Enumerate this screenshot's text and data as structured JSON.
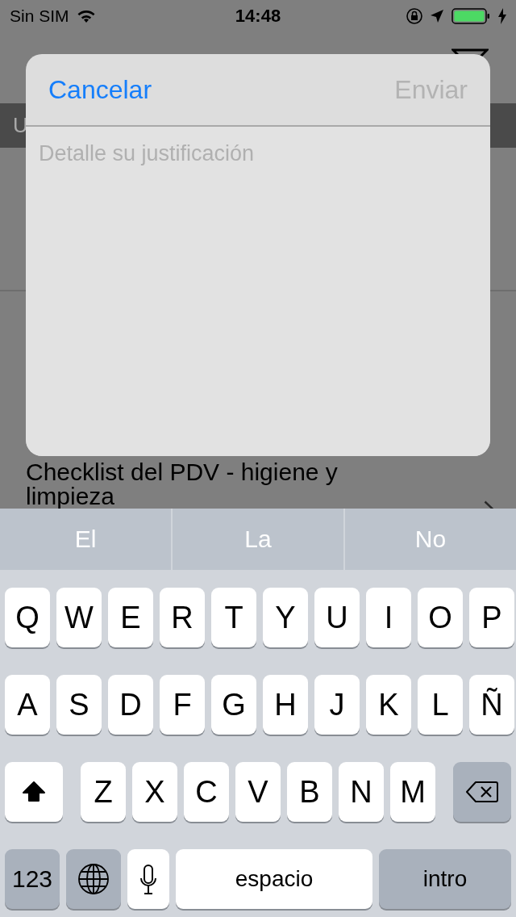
{
  "status_bar": {
    "carrier": "Sin SIM",
    "time": "14:48"
  },
  "section_header": "U",
  "list_item": {
    "title": "Checklist del PDV - higiene y limpieza"
  },
  "modal": {
    "cancel": "Cancelar",
    "send": {
      "label": "Enviar",
      "disabled": true
    },
    "placeholder": "Detalle su justificación"
  },
  "keyboard": {
    "suggestions": [
      "El",
      "La",
      "No"
    ],
    "letter_rows": [
      {
        "keys": [
          "Q",
          "W",
          "E",
          "R",
          "T",
          "Y",
          "U",
          "I",
          "O",
          "P"
        ]
      },
      {
        "keys": [
          "A",
          "S",
          "D",
          "F",
          "G",
          "H",
          "J",
          "K",
          "L",
          "Ñ"
        ]
      },
      {
        "keys": [
          "Z",
          "X",
          "C",
          "V",
          "B",
          "N",
          "M"
        ]
      }
    ],
    "shift": {
      "on": true
    },
    "bottom_keys": [
      {
        "kind": "numbers",
        "label": "123"
      },
      {
        "kind": "globe"
      },
      {
        "kind": "mic"
      },
      {
        "kind": "space",
        "label": "espacio"
      },
      {
        "kind": "return",
        "label": "intro"
      }
    ]
  }
}
